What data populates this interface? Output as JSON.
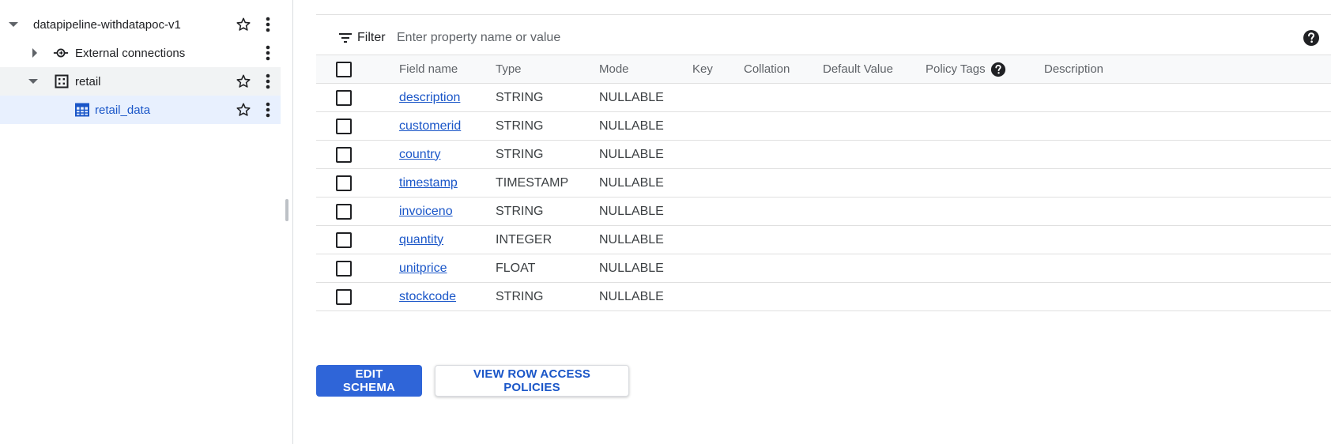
{
  "explorer": {
    "items": [
      {
        "label": "datapipeline-withdatapoc-v1",
        "icon": "caret-down-icon",
        "starred": false
      },
      {
        "label": "External connections",
        "icon": "external-connection-icon"
      },
      {
        "label": "retail",
        "icon": "dataset-icon",
        "starred": false
      },
      {
        "label": "retail_data",
        "icon": "table-icon",
        "starred": false
      }
    ]
  },
  "filter": {
    "label": "Filter",
    "placeholder": "Enter property name or value"
  },
  "schema": {
    "headers": {
      "field_name": "Field name",
      "type": "Type",
      "mode": "Mode",
      "key": "Key",
      "collation": "Collation",
      "default_value": "Default Value",
      "policy_tags": "Policy Tags",
      "description": "Description"
    },
    "rows": [
      {
        "name": "description",
        "type": "STRING",
        "mode": "NULLABLE"
      },
      {
        "name": "customerid",
        "type": "STRING",
        "mode": "NULLABLE"
      },
      {
        "name": "country",
        "type": "STRING",
        "mode": "NULLABLE"
      },
      {
        "name": "timestamp",
        "type": "TIMESTAMP",
        "mode": "NULLABLE"
      },
      {
        "name": "invoiceno",
        "type": "STRING",
        "mode": "NULLABLE"
      },
      {
        "name": "quantity",
        "type": "INTEGER",
        "mode": "NULLABLE"
      },
      {
        "name": "unitprice",
        "type": "FLOAT",
        "mode": "NULLABLE"
      },
      {
        "name": "stockcode",
        "type": "STRING",
        "mode": "NULLABLE"
      }
    ]
  },
  "actions": {
    "edit_schema": "EDIT SCHEMA",
    "view_row_access": "VIEW ROW ACCESS POLICIES"
  },
  "colors": {
    "accent": "#2f65d8",
    "link": "#1a56c8",
    "selected_row": "#e8f0fe"
  }
}
